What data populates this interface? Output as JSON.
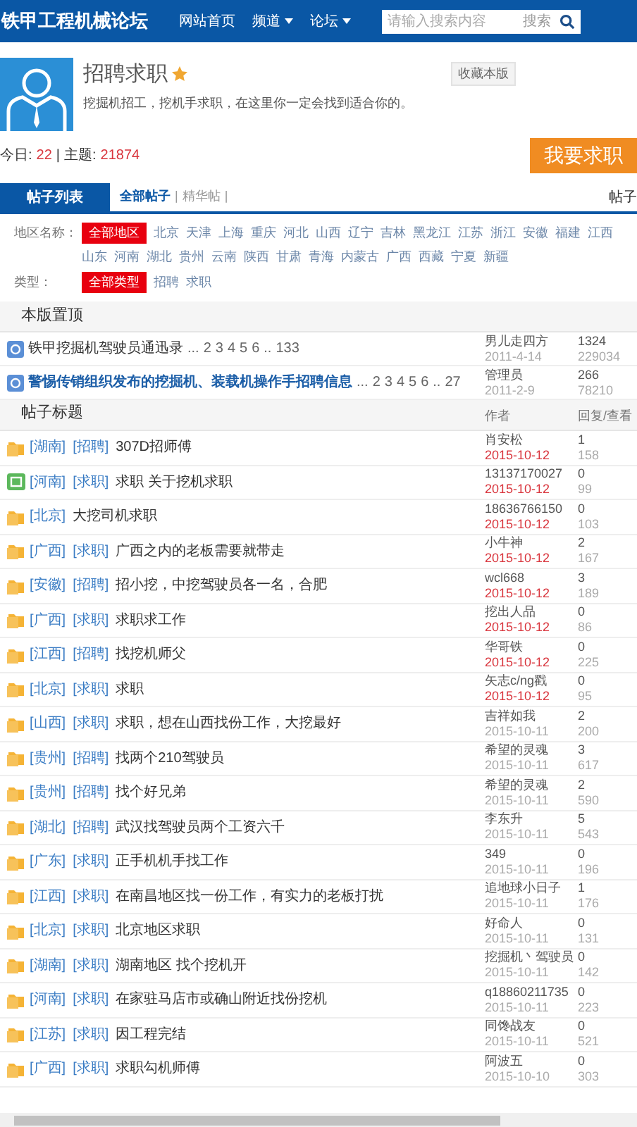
{
  "header": {
    "logo": "铁甲工程机械论坛",
    "nav": [
      {
        "label": "网站首页",
        "dropdown": false
      },
      {
        "label": "频道",
        "dropdown": true
      },
      {
        "label": "论坛",
        "dropdown": true
      }
    ],
    "search": {
      "placeholder": "请输入搜索内容",
      "button": "搜索"
    }
  },
  "forum": {
    "title": "招聘求职",
    "starred": true,
    "description": "挖掘机招工，挖机手求职，在这里你一定会找到适合你的。",
    "favorite_button": "收藏本版",
    "today_label": "今日:",
    "today": "22",
    "separator": "|",
    "topics_label": "主题:",
    "topics": "21874",
    "post_button": "我要求职"
  },
  "tabs": {
    "main": [
      {
        "label": "帖子列表",
        "selected": true
      }
    ],
    "sub": [
      {
        "label": "全部帖子",
        "selected": true
      },
      {
        "label": "精华帖",
        "selected": false
      }
    ],
    "separator": "|",
    "right": "帖子"
  },
  "filters": [
    {
      "label": "地区名称：",
      "options": [
        {
          "label": "全部地区",
          "selected": true
        },
        {
          "label": "北京",
          "selected": false
        },
        {
          "label": "天津",
          "selected": false
        },
        {
          "label": "上海",
          "selected": false
        },
        {
          "label": "重庆",
          "selected": false
        },
        {
          "label": "河北",
          "selected": false
        },
        {
          "label": "山西",
          "selected": false
        },
        {
          "label": "辽宁",
          "selected": false
        },
        {
          "label": "吉林",
          "selected": false
        },
        {
          "label": "黑龙江",
          "selected": false
        },
        {
          "label": "江苏",
          "selected": false
        },
        {
          "label": "浙江",
          "selected": false
        },
        {
          "label": "安徽",
          "selected": false
        },
        {
          "label": "福建",
          "selected": false
        },
        {
          "label": "江西",
          "selected": false
        },
        {
          "label": "山东",
          "selected": false
        },
        {
          "label": "河南",
          "selected": false
        },
        {
          "label": "湖北",
          "selected": false
        },
        {
          "label": "贵州",
          "selected": false
        },
        {
          "label": "云南",
          "selected": false
        },
        {
          "label": "陕西",
          "selected": false
        },
        {
          "label": "甘肃",
          "selected": false
        },
        {
          "label": "青海",
          "selected": false
        },
        {
          "label": "内蒙古",
          "selected": false
        },
        {
          "label": "广西",
          "selected": false
        },
        {
          "label": "西藏",
          "selected": false
        },
        {
          "label": "宁夏",
          "selected": false
        },
        {
          "label": "新疆",
          "selected": false
        }
      ]
    },
    {
      "label": "类型：",
      "options": [
        {
          "label": "全部类型",
          "selected": true
        },
        {
          "label": "招聘",
          "selected": false
        },
        {
          "label": "求职",
          "selected": false
        }
      ]
    }
  ],
  "sticky": {
    "title": "本版置顶",
    "threads": [
      {
        "title": "铁甲挖掘机驾驶员通迅录",
        "highlighted": false,
        "pages": [
          "...",
          "2",
          "3",
          "4",
          "5",
          "6",
          "..",
          "133"
        ],
        "author": "男儿走四方",
        "date": "2011-4-14",
        "replies": "1324",
        "views": "229034"
      },
      {
        "title": "警惕传销组织发布的挖掘机、装载机操作手招聘信息",
        "highlighted": true,
        "pages": [
          "...",
          "2",
          "3",
          "4",
          "5",
          "6",
          "..",
          "27"
        ],
        "author": "管理员",
        "date": "2011-2-9",
        "replies": "266",
        "views": "78210"
      }
    ]
  },
  "list": {
    "title": "帖子标题",
    "author": "作者",
    "stats": "回复/查看",
    "threads": [
      {
        "kind": "folder",
        "tags": [
          "[湖南]",
          "[招聘]"
        ],
        "title": "307D招师傅",
        "author": "肖安松",
        "date": "2015-10-12",
        "recent": true,
        "replies": "1",
        "views": "158"
      },
      {
        "kind": "new",
        "tags": [
          "[河南]",
          "[求职]"
        ],
        "title": "求职 关于挖机求职",
        "author": "13137170027",
        "date": "2015-10-12",
        "recent": true,
        "replies": "0",
        "views": "99"
      },
      {
        "kind": "folder",
        "tags": [
          "[北京]"
        ],
        "title": "大挖司机求职",
        "author": "18636766150",
        "date": "2015-10-12",
        "recent": true,
        "replies": "0",
        "views": "103"
      },
      {
        "kind": "folder",
        "tags": [
          "[广西]",
          "[求职]"
        ],
        "title": "广西之内的老板需要就带走",
        "author": "小牛神",
        "date": "2015-10-12",
        "recent": true,
        "replies": "2",
        "views": "167"
      },
      {
        "kind": "folder",
        "tags": [
          "[安徽]",
          "[招聘]"
        ],
        "title": "招小挖，中挖驾驶员各一名，合肥",
        "author": "wcl668",
        "date": "2015-10-12",
        "recent": true,
        "replies": "3",
        "views": "189"
      },
      {
        "kind": "folder",
        "tags": [
          "[广西]",
          "[求职]"
        ],
        "title": "求职求工作",
        "author": "挖出人品",
        "date": "2015-10-12",
        "recent": true,
        "replies": "0",
        "views": "86"
      },
      {
        "kind": "folder",
        "tags": [
          "[江西]",
          "[招聘]"
        ],
        "title": "找挖机师父",
        "author": "华哥铁",
        "date": "2015-10-12",
        "recent": true,
        "replies": "0",
        "views": "225"
      },
      {
        "kind": "folder",
        "tags": [
          "[北京]",
          "[求职]"
        ],
        "title": "求职",
        "author": "矢志c/ng戳",
        "date": "2015-10-12",
        "recent": true,
        "replies": "0",
        "views": "95"
      },
      {
        "kind": "folder",
        "tags": [
          "[山西]",
          "[求职]"
        ],
        "title": "求职，想在山西找份工作，大挖最好",
        "author": "吉祥如我",
        "date": "2015-10-11",
        "recent": false,
        "replies": "2",
        "views": "200"
      },
      {
        "kind": "folder",
        "tags": [
          "[贵州]",
          "[招聘]"
        ],
        "title": "找两个210驾驶员",
        "author": "希望的灵魂",
        "date": "2015-10-11",
        "recent": false,
        "replies": "3",
        "views": "617"
      },
      {
        "kind": "folder",
        "tags": [
          "[贵州]",
          "[招聘]"
        ],
        "title": "找个好兄弟",
        "author": "希望的灵魂",
        "date": "2015-10-11",
        "recent": false,
        "replies": "2",
        "views": "590"
      },
      {
        "kind": "folder",
        "tags": [
          "[湖北]",
          "[招聘]"
        ],
        "title": "武汉找驾驶员两个工资六千",
        "author": "李东升",
        "date": "2015-10-11",
        "recent": false,
        "replies": "5",
        "views": "543"
      },
      {
        "kind": "folder",
        "tags": [
          "[广东]",
          "[求职]"
        ],
        "title": "正手机机手找工作",
        "author": "349",
        "date": "2015-10-11",
        "recent": false,
        "replies": "0",
        "views": "196"
      },
      {
        "kind": "folder",
        "tags": [
          "[江西]",
          "[求职]"
        ],
        "title": "在南昌地区找一份工作，有实力的老板打扰",
        "author": "追地球小日子",
        "date": "2015-10-11",
        "recent": false,
        "replies": "1",
        "views": "176"
      },
      {
        "kind": "folder",
        "tags": [
          "[北京]",
          "[求职]"
        ],
        "title": "北京地区求职",
        "author": "好命人",
        "date": "2015-10-11",
        "recent": false,
        "replies": "0",
        "views": "131"
      },
      {
        "kind": "folder",
        "tags": [
          "[湖南]",
          "[求职]"
        ],
        "title": "湖南地区 找个挖机开",
        "author": "挖掘机丶驾驶员",
        "date": "2015-10-11",
        "recent": false,
        "replies": "0",
        "views": "142"
      },
      {
        "kind": "folder",
        "tags": [
          "[河南]",
          "[求职]"
        ],
        "title": "在家驻马店市或确山附近找份挖机",
        "author": "q18860211735",
        "date": "2015-10-11",
        "recent": false,
        "replies": "0",
        "views": "223"
      },
      {
        "kind": "folder",
        "tags": [
          "[江苏]",
          "[求职]"
        ],
        "title": "因工程完结",
        "author": "同馋战友",
        "date": "2015-10-11",
        "recent": false,
        "replies": "0",
        "views": "521"
      },
      {
        "kind": "folder",
        "tags": [
          "[广西]",
          "[求职]"
        ],
        "title": "求职勾机师傅",
        "author": "阿波五",
        "date": "2015-10-10",
        "recent": false,
        "replies": "0",
        "views": "303"
      }
    ]
  }
}
